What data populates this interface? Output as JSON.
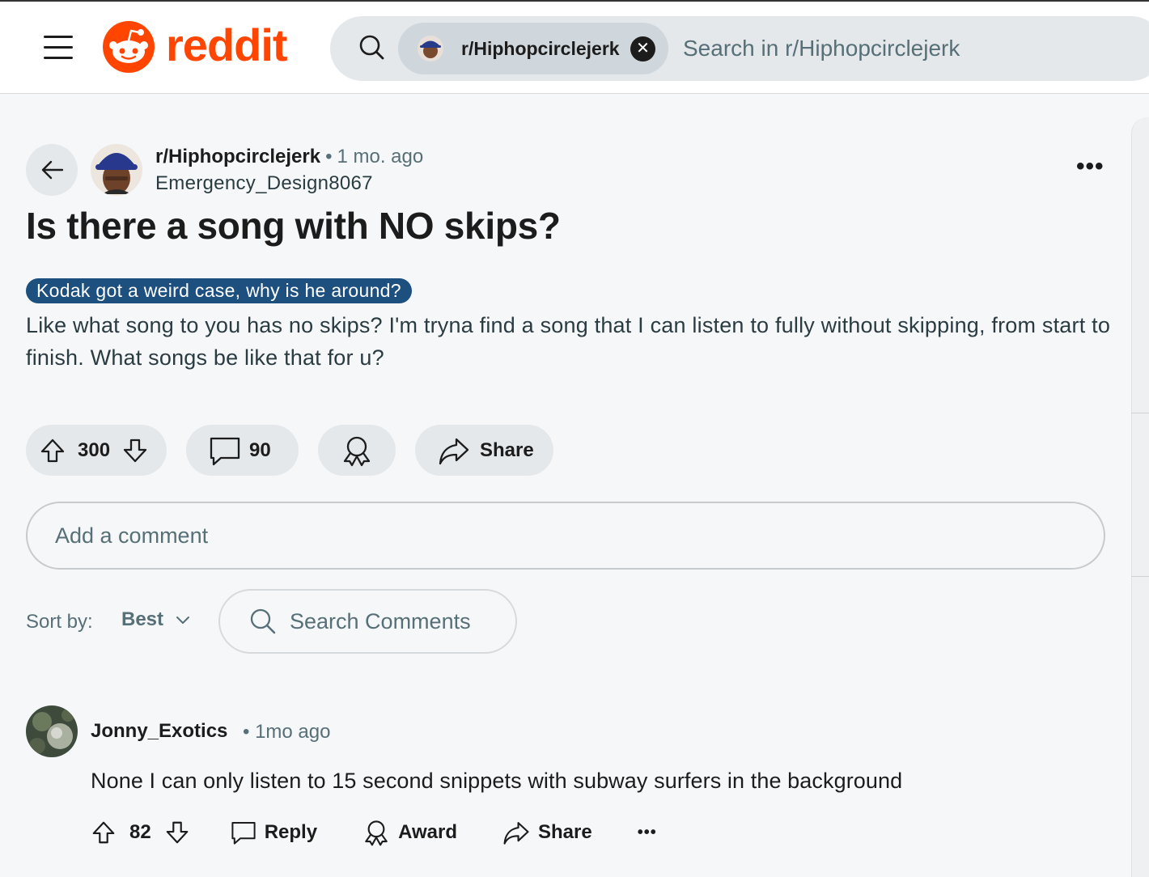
{
  "header": {
    "logo_text": "reddit",
    "brand_color": "#ff4500",
    "search_scope": "r/Hiphopcirclejerk",
    "search_placeholder": "Search in r/Hiphopcirclejerk"
  },
  "post": {
    "subreddit": "r/Hiphopcirclejerk",
    "separator": "•",
    "time": "1 mo. ago",
    "author": "Emergency_Design8067",
    "more": "•••",
    "title": "Is there a song with NO skips?",
    "flair": "Kodak got a weird case, why is he around?",
    "flair_color": "#1d4f7f",
    "body": "Like what song to you has no skips? I'm tryna find a song that I can listen to fully without skipping, from start to finish. What songs be like that for u?",
    "votes": "300",
    "comments": "90",
    "share_label": "Share"
  },
  "comment_box": {
    "placeholder": "Add a comment"
  },
  "sort": {
    "label": "Sort by:",
    "value": "Best",
    "search_placeholder": "Search Comments"
  },
  "comments": [
    {
      "author": "Jonny_Exotics",
      "time": "• 1mo ago",
      "text": "None I can only listen to 15 second snippets with subway surfers in the background",
      "votes": "82",
      "reply_label": "Reply",
      "award_label": "Award",
      "share_label": "Share",
      "more": "•••"
    }
  ]
}
